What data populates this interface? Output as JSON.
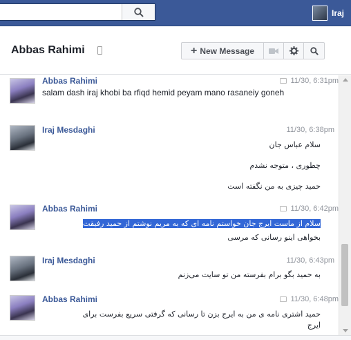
{
  "topbar": {
    "search_placeholder": "",
    "search_icon": "search-icon",
    "user_name": "Iraj"
  },
  "header": {
    "title": "Abbas Rahimi",
    "new_message_label": "New Message",
    "video_icon": "video-camera-icon",
    "settings_icon": "gear-icon",
    "search_icon": "search-icon"
  },
  "messages": [
    {
      "sender": "Abbas Rahimi",
      "time": "11/30, 6:31pm",
      "lines": [
        "salam dash iraj khobi ba rfiqd hemid peyam mano rasaneiy goneh"
      ]
    },
    {
      "sender": "Iraj Mesdaghi",
      "time": "11/30, 6:38pm",
      "lines": [
        "سلام عباس جان",
        "چطوری ، متوجه نشدم",
        "حمید چیزی به من نگفته است"
      ]
    },
    {
      "sender": "Abbas Rahimi",
      "time": "11/30, 6:42pm",
      "lines": [
        "سلام از ماست ایرج جان خواستم نامه ای که به مریم نوشتم از حمید رفیقت",
        "بخواهی اینو رسانی که مرسی"
      ]
    },
    {
      "sender": "Iraj Mesdaghi",
      "time": "11/30, 6:43pm",
      "lines": [
        "به حمید بگو برام بفرسته من تو سایت می‌زنم"
      ]
    },
    {
      "sender": "Abbas Rahimi",
      "time": "11/30, 6:48pm",
      "lines": [
        "حمید اشتری نامه ی من به ایرج بزن تا رسانی که گرفتی سریع بفرست برای",
        "ایرج"
      ]
    }
  ]
}
